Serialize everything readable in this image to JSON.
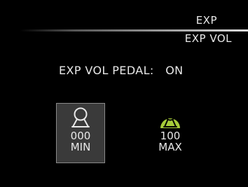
{
  "header": {
    "category": "EXP",
    "page": "EXP VOL"
  },
  "parameter": {
    "name": "EXP VOL PEDAL:",
    "value": "ON"
  },
  "knobs": [
    {
      "value": "000",
      "label": "MIN",
      "icon": "person-icon",
      "selected": true,
      "color": "#ffffff"
    },
    {
      "value": "100",
      "label": "MAX",
      "icon": "person-icon",
      "selected": false,
      "color": "#a6cc3a"
    }
  ],
  "colors": {
    "background": "#000000",
    "text": "#e8e8e8",
    "accent": "#a6cc3a",
    "selection": "#3a3a3a"
  }
}
